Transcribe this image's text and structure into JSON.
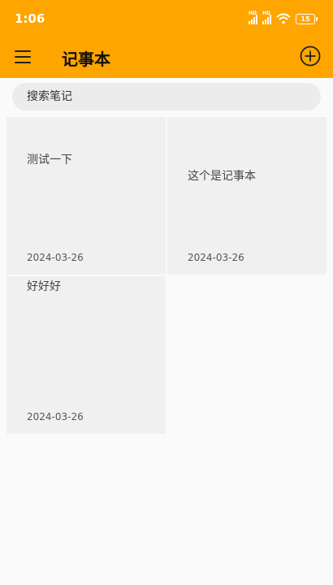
{
  "status_bar": {
    "time": "1:06",
    "battery": "15",
    "signal_1": "HD",
    "signal_2": "HD"
  },
  "app_bar": {
    "title": "记事本",
    "menu_icon": "hamburger-menu-icon",
    "add_icon": "plus-circle-icon",
    "background": "#ffa500"
  },
  "search": {
    "placeholder": "搜索笔记",
    "value": ""
  },
  "notes": [
    {
      "title": "测试一下",
      "date": "2024-03-26"
    },
    {
      "title": "这个是记事本",
      "date": "2024-03-26"
    },
    {
      "title": "好好好",
      "date": "2024-03-26"
    }
  ]
}
